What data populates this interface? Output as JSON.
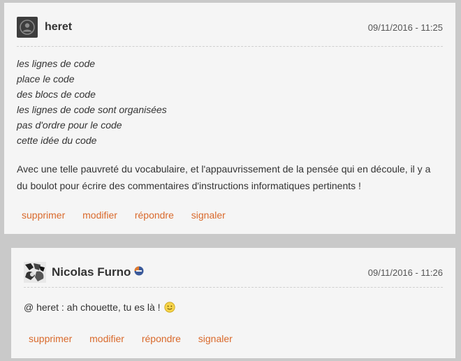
{
  "comments": [
    {
      "author": "heret",
      "date": "09/11/2016 - 11:25",
      "code_lines": [
        "les lignes de code",
        "place le code",
        "des blocs de code",
        "les lignes de code sont organisées",
        "pas d'ordre pour le code",
        "cette idée du code"
      ],
      "paragraph": "Avec une telle pauvreté du vocabulaire, et l'appauvrissement de la pensée qui en découle, il y a du boulot pour écrire des commentaires d'instructions informatiques pertinents !",
      "avatar_icon": "default-user-icon",
      "actions": [
        "supprimer",
        "modifier",
        "répondre",
        "signaler"
      ]
    },
    {
      "author": "Nicolas Furno",
      "date": "09/11/2016 - 11:26",
      "text": "@ heret : ah chouette, tu es là !",
      "emoji_icon": "smiley-icon",
      "badge_icon": "member-badge-icon",
      "actions": [
        "supprimer",
        "modifier",
        "répondre",
        "signaler"
      ]
    }
  ],
  "colors": {
    "background": "#c9c9c9",
    "card": "#f5f5f5",
    "action": "#d9692b",
    "text": "#333333"
  }
}
